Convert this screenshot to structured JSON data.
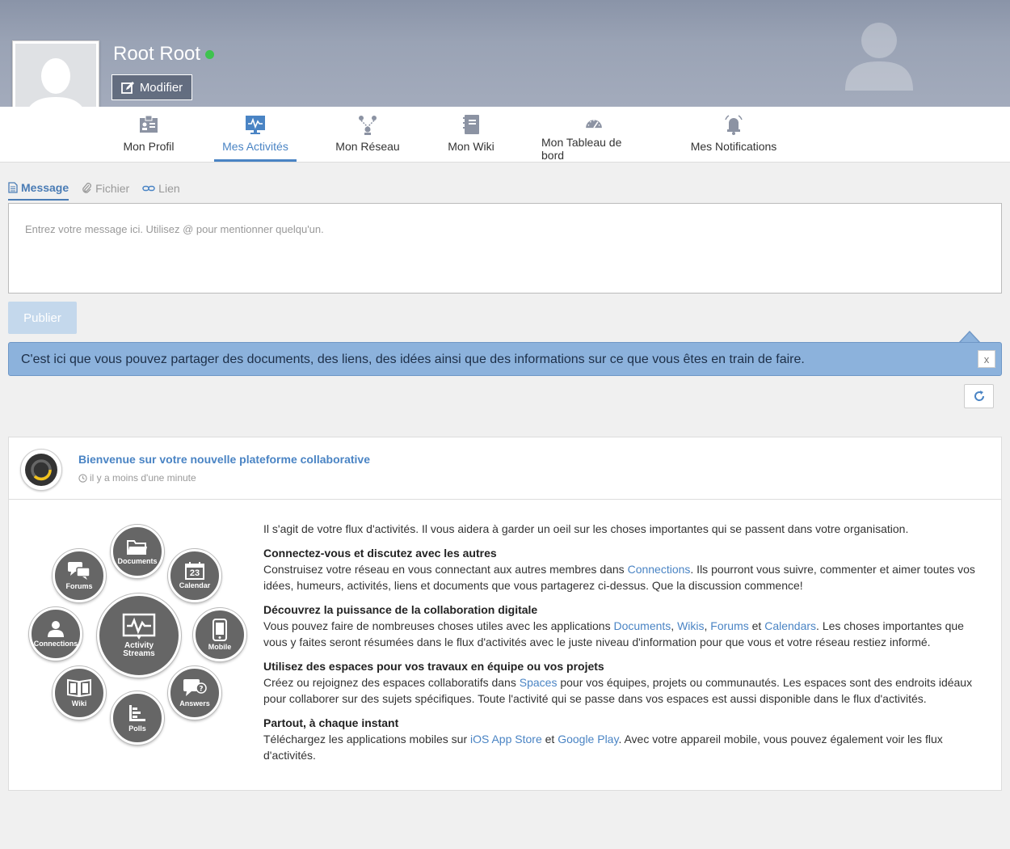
{
  "profile": {
    "name": "Root Root",
    "status_color": "#3ec34e",
    "edit_label": "Modifier"
  },
  "nav": {
    "tabs": [
      {
        "label": "Mon Profil",
        "icon": "profile-icon",
        "active": false
      },
      {
        "label": "Mes Activités",
        "icon": "activity-icon",
        "active": true
      },
      {
        "label": "Mon Réseau",
        "icon": "network-icon",
        "active": false
      },
      {
        "label": "Mon Wiki",
        "icon": "wiki-icon",
        "active": false
      },
      {
        "label": "Mon Tableau de bord",
        "icon": "dashboard-icon",
        "active": false
      },
      {
        "label": "Mes Notifications",
        "icon": "notification-icon",
        "active": false
      }
    ]
  },
  "composer": {
    "tabs": [
      {
        "label": "Message",
        "icon": "message-icon",
        "active": true
      },
      {
        "label": "Fichier",
        "icon": "paperclip-icon",
        "active": false
      },
      {
        "label": "Lien",
        "icon": "link-icon",
        "active": false
      }
    ],
    "placeholder": "Entrez votre message ici. Utilisez @ pour mentionner quelqu'un.",
    "publish_label": "Publier"
  },
  "tip": {
    "text": "C'est ici que vous pouvez partager des documents, des liens, des idées ainsi que des informations sur ce que vous êtes en train de faire.",
    "close_label": "x"
  },
  "activity": {
    "title": "Bienvenue sur votre nouvelle plateforme collaborative",
    "time": "il y a moins d'une minute",
    "intro": "Il s'agit de votre flux d'activités. Il vous aidera à garder un oeil sur les choses importantes qui se passent dans votre organisation.",
    "s1_title": "Connectez-vous et discutez avec les autres",
    "s1_a": "Construisez votre réseau en vous connectant aux autres membres dans ",
    "s1_link": "Connections",
    "s1_b": ". Ils pourront vous suivre, commenter et aimer toutes vos idées, humeurs, activités, liens et documents que vous partagerez ci-dessus. Que la discussion commence!",
    "s2_title": "Découvrez la puissance de la collaboration digitale",
    "s2_a": "Vous pouvez faire de nombreuses choses utiles avec les applications ",
    "s2_l1": "Documents",
    "s2_c1": ", ",
    "s2_l2": "Wikis",
    "s2_c2": ", ",
    "s2_l3": "Forums",
    "s2_c3": " et ",
    "s2_l4": "Calendars",
    "s2_b": ". Les choses importantes que vous y faites seront résumées dans le flux d'activités avec le juste niveau d'information pour que vous et votre réseau restiez informé.",
    "s3_title": "Utilisez des espaces pour vos travaux en équipe ou vos projets",
    "s3_a": "Créez ou rejoignez des espaces collaboratifs dans ",
    "s3_link": "Spaces",
    "s3_b": " pour vos équipes, projets ou communautés. Les espaces sont des endroits idéaux pour collaborer sur des sujets spécifiques. Toute l'activité qui se passe dans vos espaces est aussi disponible dans le flux d'activités.",
    "s4_title": "Partout, à chaque instant",
    "s4_a": "Téléchargez les applications mobiles sur ",
    "s4_l1": "iOS App Store",
    "s4_c1": " et ",
    "s4_l2": "Google Play",
    "s4_b": ". Avec votre appareil mobile, vous pouvez également voir les flux d'activités."
  },
  "diagram": {
    "center_1": "Activity",
    "center_2": "Streams",
    "documents": "Documents",
    "calendar": "Calendar",
    "calendar_day": "23",
    "forums": "Forums",
    "connections": "Connections",
    "mobile": "Mobile",
    "wiki": "Wiki",
    "answers": "Answers",
    "polls": "Polls"
  },
  "colors": {
    "accent": "#4a84c4",
    "tip_bg": "#8cb2dc",
    "publish_disabled": "#c4d8ec"
  }
}
